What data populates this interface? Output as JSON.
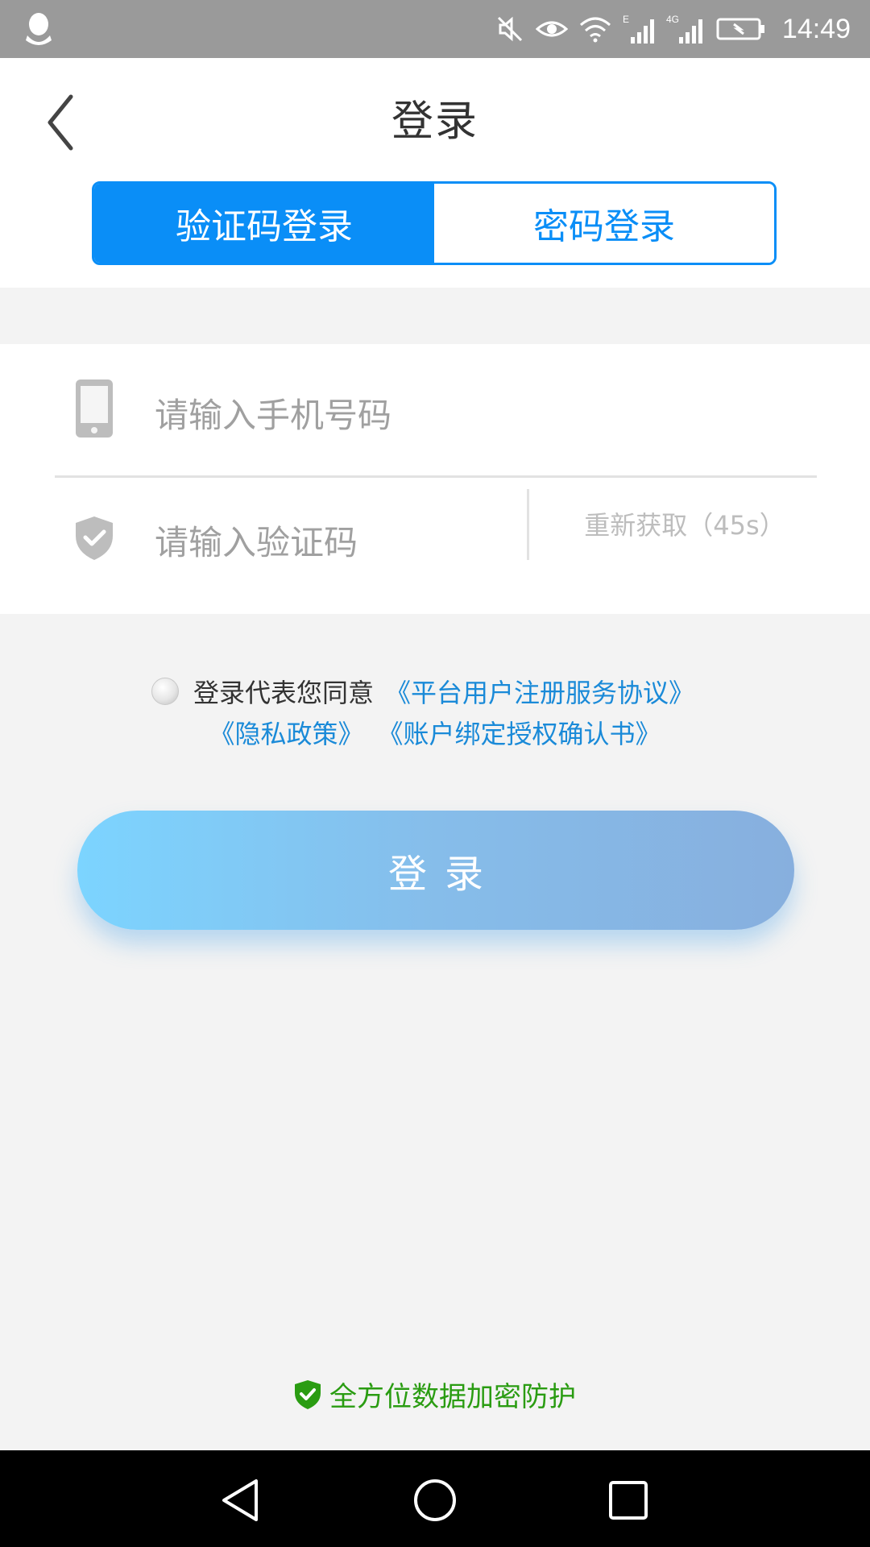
{
  "status_bar": {
    "time": "14:49",
    "network_label_1": "E",
    "network_label_2": "4G"
  },
  "header": {
    "title": "登录",
    "tabs": [
      {
        "label": "验证码登录",
        "active": true
      },
      {
        "label": "密码登录",
        "active": false
      }
    ]
  },
  "form": {
    "phone_placeholder": "请输入手机号码",
    "code_placeholder": "请输入验证码",
    "resend_label": "重新获取（45s）"
  },
  "agreement": {
    "prefix": "登录代表您同意",
    "links": [
      "《平台用户注册服务协议》",
      "《隐私政策》",
      "《账户绑定授权确认书》"
    ]
  },
  "login_button": {
    "label": "登录"
  },
  "security_note": "全方位数据加密防护",
  "colors": {
    "primary": "#0a8ef7",
    "link": "#1a8ad8",
    "security": "#2a9c12"
  }
}
